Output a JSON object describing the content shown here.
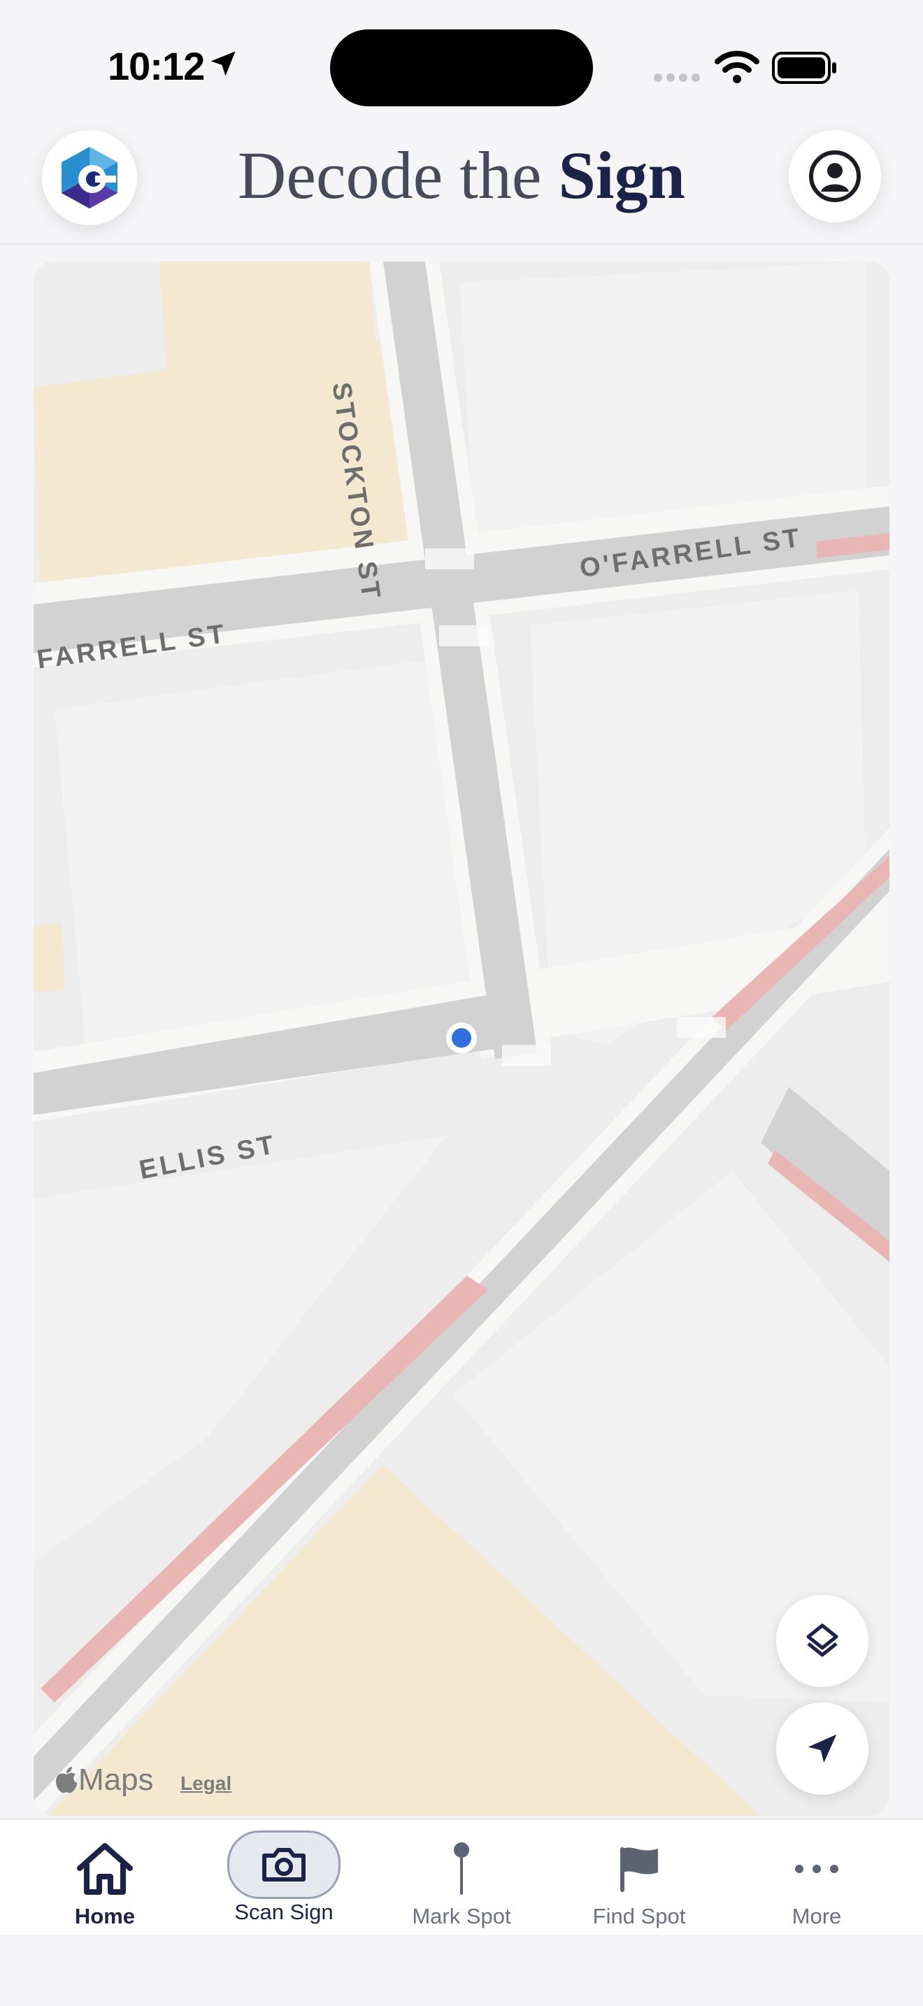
{
  "status_bar": {
    "time": "10:12"
  },
  "header": {
    "title_light": "Decode the",
    "title_bold": "Sign"
  },
  "map": {
    "streets": {
      "stockton": "STOCKTON ST",
      "ofarrell_right": "O'FARRELL ST",
      "ofarrell_left": "FARRELL ST",
      "ellis": "ELLIS ST"
    },
    "attribution": {
      "brand": "Maps",
      "legal": "Legal"
    }
  },
  "tabs": [
    {
      "label": "Home",
      "icon": "house-icon",
      "active": true
    },
    {
      "label": "Scan Sign",
      "icon": "camera-icon",
      "active": false
    },
    {
      "label": "Mark Spot",
      "icon": "pin-icon",
      "active": false
    },
    {
      "label": "Find Spot",
      "icon": "flag-icon",
      "active": false
    },
    {
      "label": "More",
      "icon": "ellipsis-icon",
      "active": false
    }
  ],
  "colors": {
    "brand_navy": "#1b2348",
    "map_road": "#d2d2d2",
    "map_block": "#ececec",
    "map_poi": "#f5e8d0",
    "transit_lane": "#e9b6b4",
    "user_dot": "#2f6fe0"
  }
}
